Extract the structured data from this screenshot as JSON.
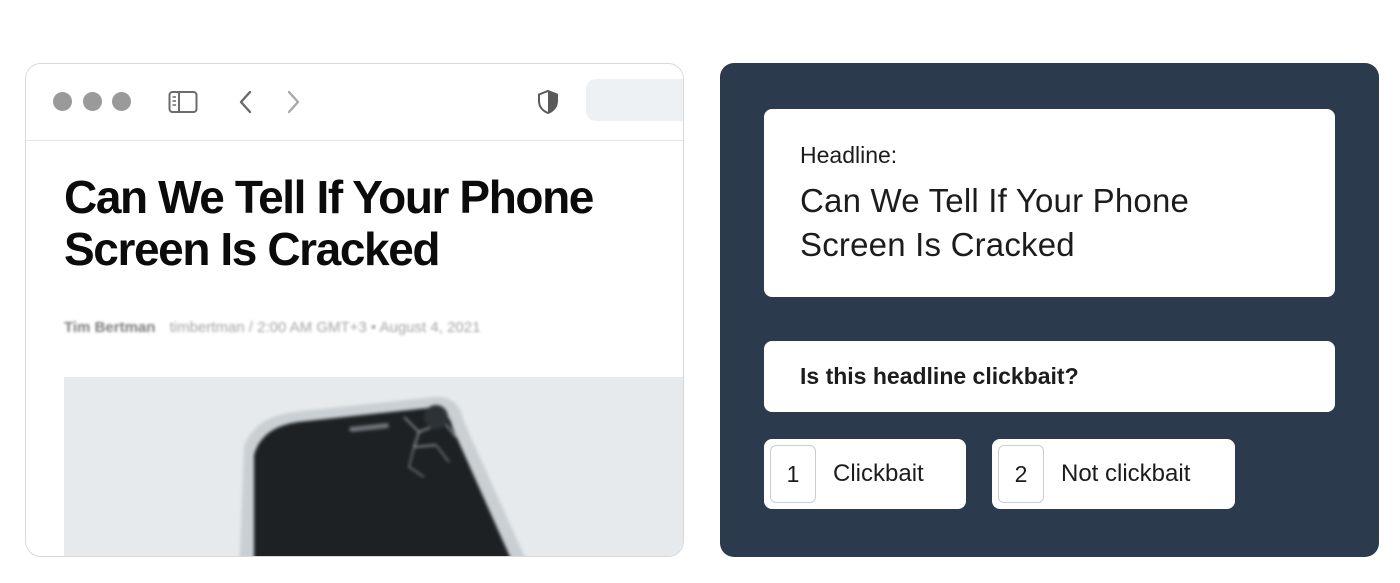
{
  "browser": {
    "article": {
      "headline": "Can We Tell If Your Phone Screen Is Cracked",
      "author": "Tim Bertman",
      "handle": "timbertman",
      "meta": "/ 2:00 AM GMT+3 • August 4, 2021"
    },
    "icons": {
      "sidebar": "sidebar-icon",
      "back": "chevron-left-icon",
      "forward": "chevron-right-icon",
      "privacy": "shield-icon"
    }
  },
  "task": {
    "headline_label": "Headline:",
    "headline_text": "Can We Tell If Your Phone Screen Is Cracked",
    "question": "Is this headline clickbait?",
    "options": [
      {
        "key": "1",
        "label": "Clickbait"
      },
      {
        "key": "2",
        "label": "Not clickbait"
      }
    ]
  },
  "colors": {
    "panel_bg": "#2b3a4d",
    "card_bg": "#ffffff",
    "traffic_light": "#9a9a9a"
  }
}
